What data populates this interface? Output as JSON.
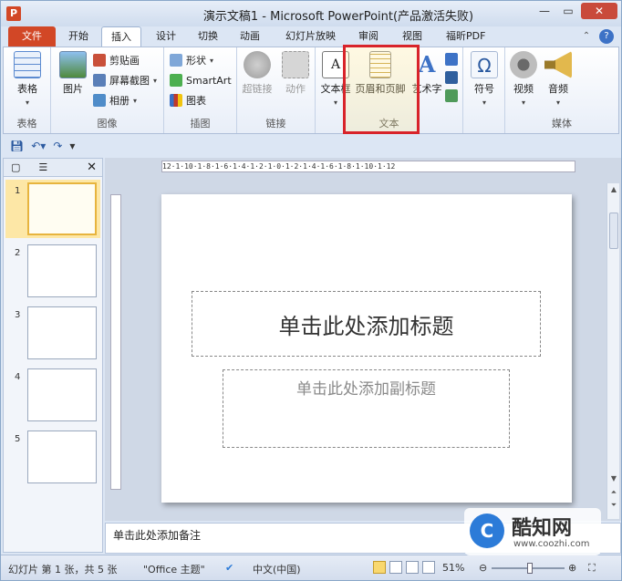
{
  "titlebar": {
    "title": "演示文稿1 - Microsoft PowerPoint(产品激活失败)",
    "app_icon": "P"
  },
  "tabs": {
    "file": "文件",
    "items": [
      "开始",
      "插入",
      "设计",
      "切换",
      "动画",
      "幻灯片放映",
      "审阅",
      "视图",
      "福昕PDF"
    ],
    "active": "插入"
  },
  "ribbon": {
    "groups": {
      "tables": "表格",
      "images": "图像",
      "illustrations": "插图",
      "links": "链接",
      "text": "文本",
      "media": "媒体"
    },
    "buttons": {
      "table": "表格",
      "picture": "图片",
      "clip_art": "剪贴画",
      "screenshot": "屏幕截图",
      "album": "相册",
      "shapes": "形状",
      "smartart": "SmartArt",
      "chart": "图表",
      "hyperlink": "超链接",
      "action": "动作",
      "textbox": "文本框",
      "header_footer": "页眉和页脚",
      "wordart": "艺术字",
      "symbol": "符号",
      "video": "视频",
      "audio": "音频"
    },
    "highlight_color": "#d8232a"
  },
  "slidepane": {
    "thumbnails": [
      "1",
      "2",
      "3",
      "4",
      "5"
    ],
    "selected": "1"
  },
  "ruler": {
    "h_text": "12·1·10·1·8·1·6·1·4·1·2·1·0·1·2·1·4·1·6·1·8·1·10·1·12"
  },
  "slide": {
    "title_placeholder": "单击此处添加标题",
    "subtitle_placeholder": "单击此处添加副标题"
  },
  "notes": {
    "placeholder": "单击此处添加备注"
  },
  "status": {
    "slide_info": "幻灯片 第 1 张，共 5 张",
    "theme": "\"Office 主题\"",
    "language": "中文(中国)",
    "zoom": "51%"
  },
  "watermark": {
    "name": "酷知网",
    "url": "www.coozhi.com"
  },
  "colors": {
    "file_tab": "#d24726",
    "accent": "#2c5aa0"
  }
}
